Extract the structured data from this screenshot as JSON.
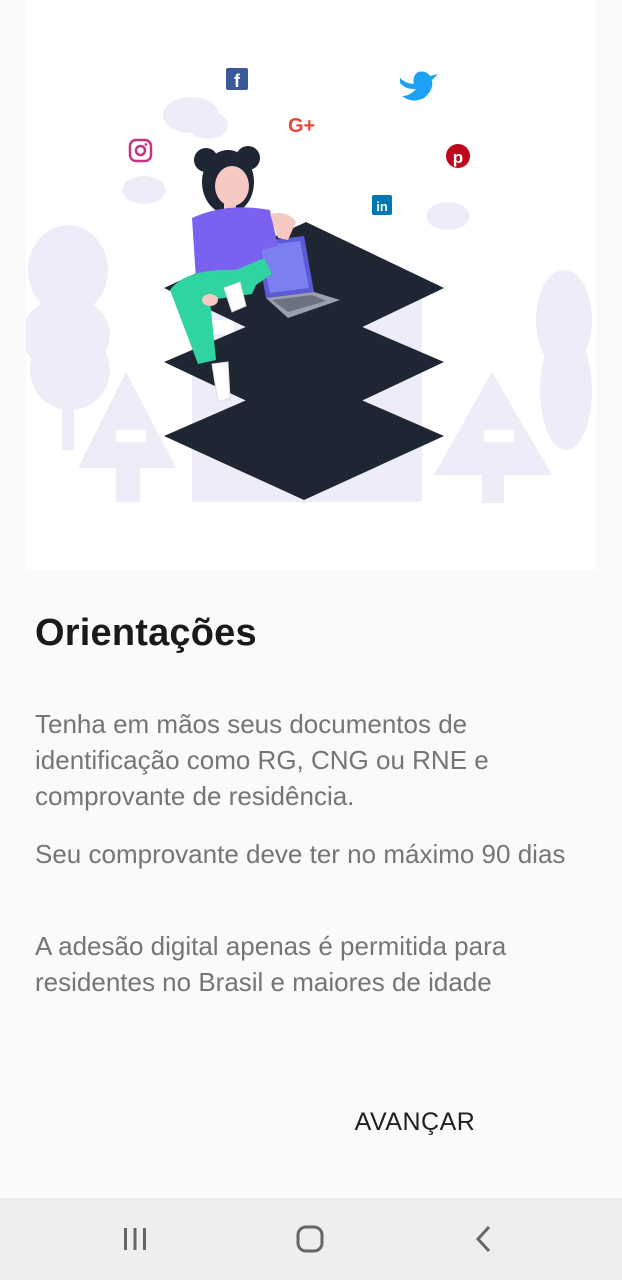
{
  "orientation": {
    "title": "Orientações",
    "paragraphs": [
      "Tenha em mãos seus documentos de identificação como RG, CNG ou RNE e comprovante de residência.",
      "Seu comprovante deve ter no máximo 90 dias",
      "A adesão digital apenas é permitida para residentes no Brasil e maiores de idade"
    ],
    "next_label": "AVANÇAR"
  },
  "illustration": {
    "social_icons": [
      "facebook-icon",
      "twitter-icon",
      "google-plus-icon",
      "instagram-icon",
      "pinterest-icon",
      "linkedin-icon"
    ],
    "colors": {
      "facebook": "#3b5998",
      "twitter": "#1da1f2",
      "google_plus": "#dd4b39",
      "instagram": "#c13584",
      "pinterest": "#bd081c",
      "linkedin": "#0077b5",
      "stack": "#1f2633",
      "shirt": "#7b61f0",
      "pants": "#2fd4a0",
      "background_shapes": "#ededfa"
    }
  },
  "nav_bar": {
    "buttons": [
      "recent-apps",
      "home",
      "back"
    ]
  }
}
